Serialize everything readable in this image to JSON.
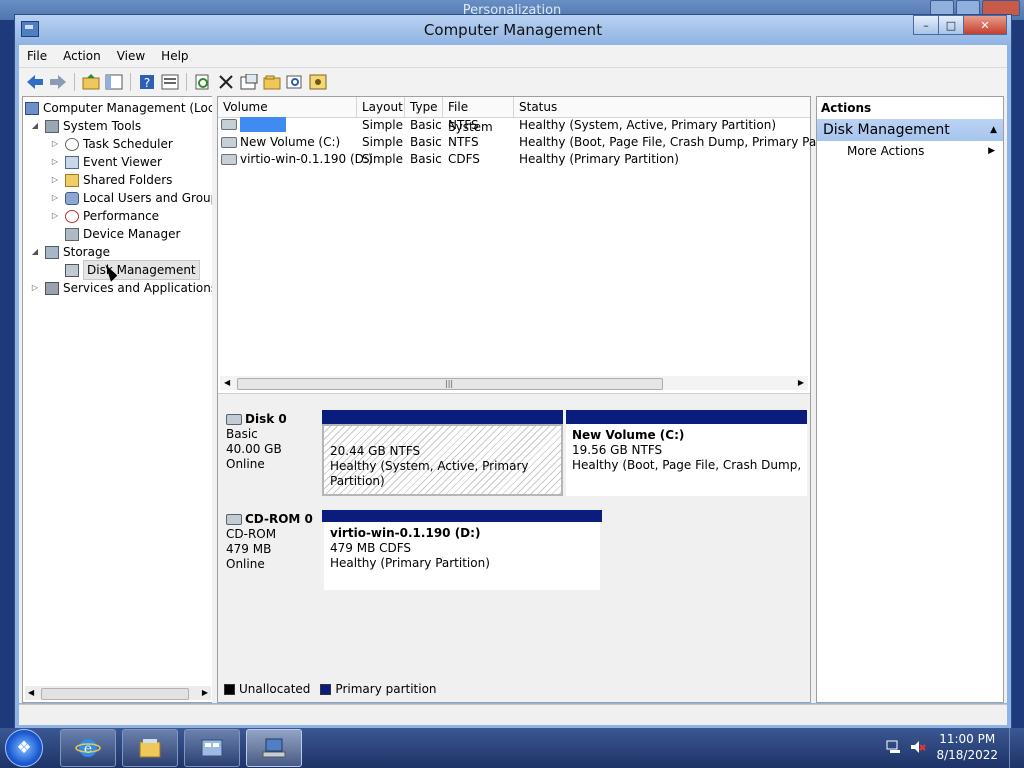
{
  "background_window": {
    "title": "Personalization"
  },
  "window": {
    "title": "Computer Management",
    "controls": {
      "minimize": "–",
      "maximize": "□",
      "close": "✕"
    }
  },
  "menu": [
    "File",
    "Action",
    "View",
    "Help"
  ],
  "toolbar": [
    "back-icon",
    "forward-icon",
    "up-folder-icon",
    "show-hide-tree-icon",
    "help-icon",
    "properties-icon",
    "refresh-icon",
    "delete-icon",
    "properties-sheet-icon",
    "open-icon",
    "search-icon",
    "settings-icon"
  ],
  "tree": {
    "root": "Computer Management (Local",
    "system_tools": "System Tools",
    "task_scheduler": "Task Scheduler",
    "event_viewer": "Event Viewer",
    "shared_folders": "Shared Folders",
    "local_users": "Local Users and Groups",
    "performance": "Performance",
    "device_manager": "Device Manager",
    "storage": "Storage",
    "disk_management": "Disk Management",
    "services": "Services and Applications"
  },
  "volume_list": {
    "headers": [
      "Volume",
      "Layout",
      "Type",
      "File System",
      "Status"
    ],
    "rows": [
      {
        "volume": "",
        "layout": "Simple",
        "type": "Basic",
        "fs": "NTFS",
        "status": "Healthy (System, Active, Primary Partition)"
      },
      {
        "volume": "New Volume (C:)",
        "layout": "Simple",
        "type": "Basic",
        "fs": "NTFS",
        "status": "Healthy (Boot, Page File, Crash Dump, Primary Partition"
      },
      {
        "volume": "virtio-win-0.1.190 (D:)",
        "layout": "Simple",
        "type": "Basic",
        "fs": "CDFS",
        "status": "Healthy (Primary Partition)"
      }
    ]
  },
  "disks": [
    {
      "name": "Disk 0",
      "kind": "Basic",
      "size": "40.00 GB",
      "state": "Online",
      "partitions": [
        {
          "label": "",
          "size": "20.44 GB NTFS",
          "status": "Healthy (System, Active, Primary Partition)"
        },
        {
          "label": "New Volume  (C:)",
          "size": "19.56 GB NTFS",
          "status": "Healthy (Boot, Page File, Crash Dump, Prim"
        }
      ]
    },
    {
      "name": "CD-ROM 0",
      "kind": "CD-ROM",
      "size": "479 MB",
      "state": "Online",
      "partitions": [
        {
          "label": "virtio-win-0.1.190  (D:)",
          "size": "479 MB CDFS",
          "status": "Healthy (Primary Partition)"
        }
      ]
    }
  ],
  "legend": {
    "unallocated": "Unallocated",
    "primary": "Primary partition",
    "unallocated_color": "#000000",
    "primary_color": "#0b1d7c"
  },
  "actions": {
    "header": "Actions",
    "group": "Disk Management",
    "item": "More Actions"
  },
  "taskbar": {
    "time": "11:00 PM",
    "date": "8/18/2022"
  }
}
